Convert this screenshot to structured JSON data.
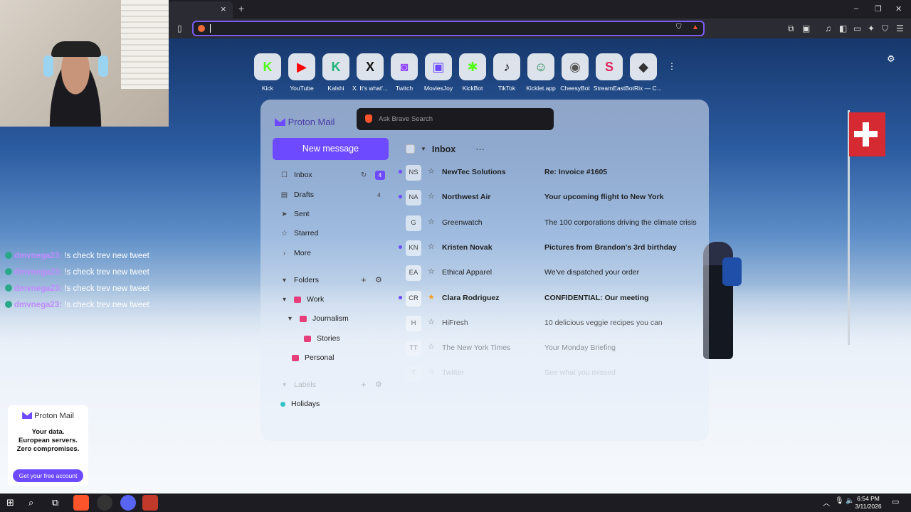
{
  "browser": {
    "url_value": "",
    "new_tab_symbol": "+",
    "close_tab_symbol": "×",
    "window_controls": [
      "–",
      "❐",
      "✕"
    ]
  },
  "speed_dial": [
    {
      "label": "Kick",
      "glyph": "K",
      "color": "#53fc18"
    },
    {
      "label": "YouTube",
      "glyph": "▶",
      "color": "#ff0000"
    },
    {
      "label": "Kalshi",
      "glyph": "K",
      "color": "#1fb47a"
    },
    {
      "label": "X. It's what'...",
      "glyph": "X",
      "color": "#111111"
    },
    {
      "label": "Twitch",
      "glyph": "◙",
      "color": "#9146ff"
    },
    {
      "label": "MoviesJoy",
      "glyph": "▣",
      "color": "#6d4aff"
    },
    {
      "label": "KickBot",
      "glyph": "✱",
      "color": "#53fc18"
    },
    {
      "label": "TikTok",
      "glyph": "♪",
      "color": "#111111"
    },
    {
      "label": "Kicklet.app",
      "glyph": "☺",
      "color": "#2e8b57"
    },
    {
      "label": "CheesyBot",
      "glyph": "◉",
      "color": "#555555"
    },
    {
      "label": "StreamEast",
      "glyph": "S",
      "color": "#e0245e"
    },
    {
      "label": "BotRix — C...",
      "glyph": "◆",
      "color": "#333333"
    }
  ],
  "brave_search": {
    "placeholder": "Ask Brave Search"
  },
  "proton": {
    "logo": "Proton Mail",
    "new_message": "New message",
    "inbox_title": "Inbox",
    "inbox_menu": "⋯",
    "nav": [
      {
        "label": "Inbox",
        "icon": "inbox-icon",
        "glyph": "☐",
        "count": "4"
      },
      {
        "label": "Drafts",
        "icon": "file-icon",
        "glyph": "▤",
        "count": "4"
      },
      {
        "label": "Sent",
        "icon": "send-icon",
        "glyph": "➤",
        "count": ""
      },
      {
        "label": "Starred",
        "icon": "star-icon",
        "glyph": "☆",
        "count": ""
      },
      {
        "label": "More",
        "icon": "chevron-right-icon",
        "glyph": "›",
        "count": ""
      }
    ],
    "folders_label": "Folders",
    "folders": [
      {
        "label": "Work",
        "color": "#e63e7b"
      },
      {
        "label": "Journalism",
        "color": "#e63e7b"
      },
      {
        "label": "Stories",
        "color": "#e63e7b"
      },
      {
        "label": "Personal",
        "color": "#e63e7b"
      }
    ],
    "labels_label": "Labels",
    "labels": [
      {
        "label": "Holidays",
        "color": "#2fc4c4"
      }
    ],
    "messages": [
      {
        "initials": "NS",
        "from": "NewTec Solutions",
        "subject": "Re: Invoice #1605",
        "unread": true,
        "starred": false
      },
      {
        "initials": "NA",
        "from": "Northwest Air",
        "subject": "Your upcoming flight to New York",
        "unread": true,
        "starred": false
      },
      {
        "initials": "G",
        "from": "Greenwatch",
        "subject": "The 100 corporations driving the climate crisis",
        "unread": false,
        "starred": false
      },
      {
        "initials": "KN",
        "from": "Kristen Novak",
        "subject": "Pictures from Brandon's 3rd birthday",
        "unread": true,
        "starred": false
      },
      {
        "initials": "EA",
        "from": "Ethical Apparel",
        "subject": "We've dispatched your order",
        "unread": false,
        "starred": false
      },
      {
        "initials": "CR",
        "from": "Clara Rodriguez",
        "subject": "CONFIDENTIAL: Our meeting",
        "unread": true,
        "starred": true
      },
      {
        "initials": "H",
        "from": "HiFresh",
        "subject": "10 delicious veggie recipes you can",
        "unread": false,
        "starred": false
      },
      {
        "initials": "TT",
        "from": "The New York Times",
        "subject": "Your Monday Briefing",
        "unread": false,
        "starred": false
      },
      {
        "initials": "T",
        "from": "Twitter",
        "subject": "See what you missed",
        "unread": false,
        "starred": false
      }
    ]
  },
  "chat": [
    {
      "user": "dmvnega23:",
      "message": "!s check trev new tweet"
    },
    {
      "user": "dmvnega23:",
      "message": "!s check trev new tweet"
    },
    {
      "user": "dmvnega23:",
      "message": "!s check trev new tweet"
    },
    {
      "user": "dmvnega23:",
      "message": "!s check trev new tweet"
    }
  ],
  "ad": {
    "logo": "Proton Mail",
    "line1": "Your data.",
    "line2": "European servers.",
    "line3": "Zero compromises.",
    "cta": "Get your free account"
  },
  "taskbar": {
    "time": "6:54 PM",
    "date": "3/11/2026"
  },
  "colors": {
    "accent": "#6d4aff",
    "brave": "#fb542b"
  }
}
